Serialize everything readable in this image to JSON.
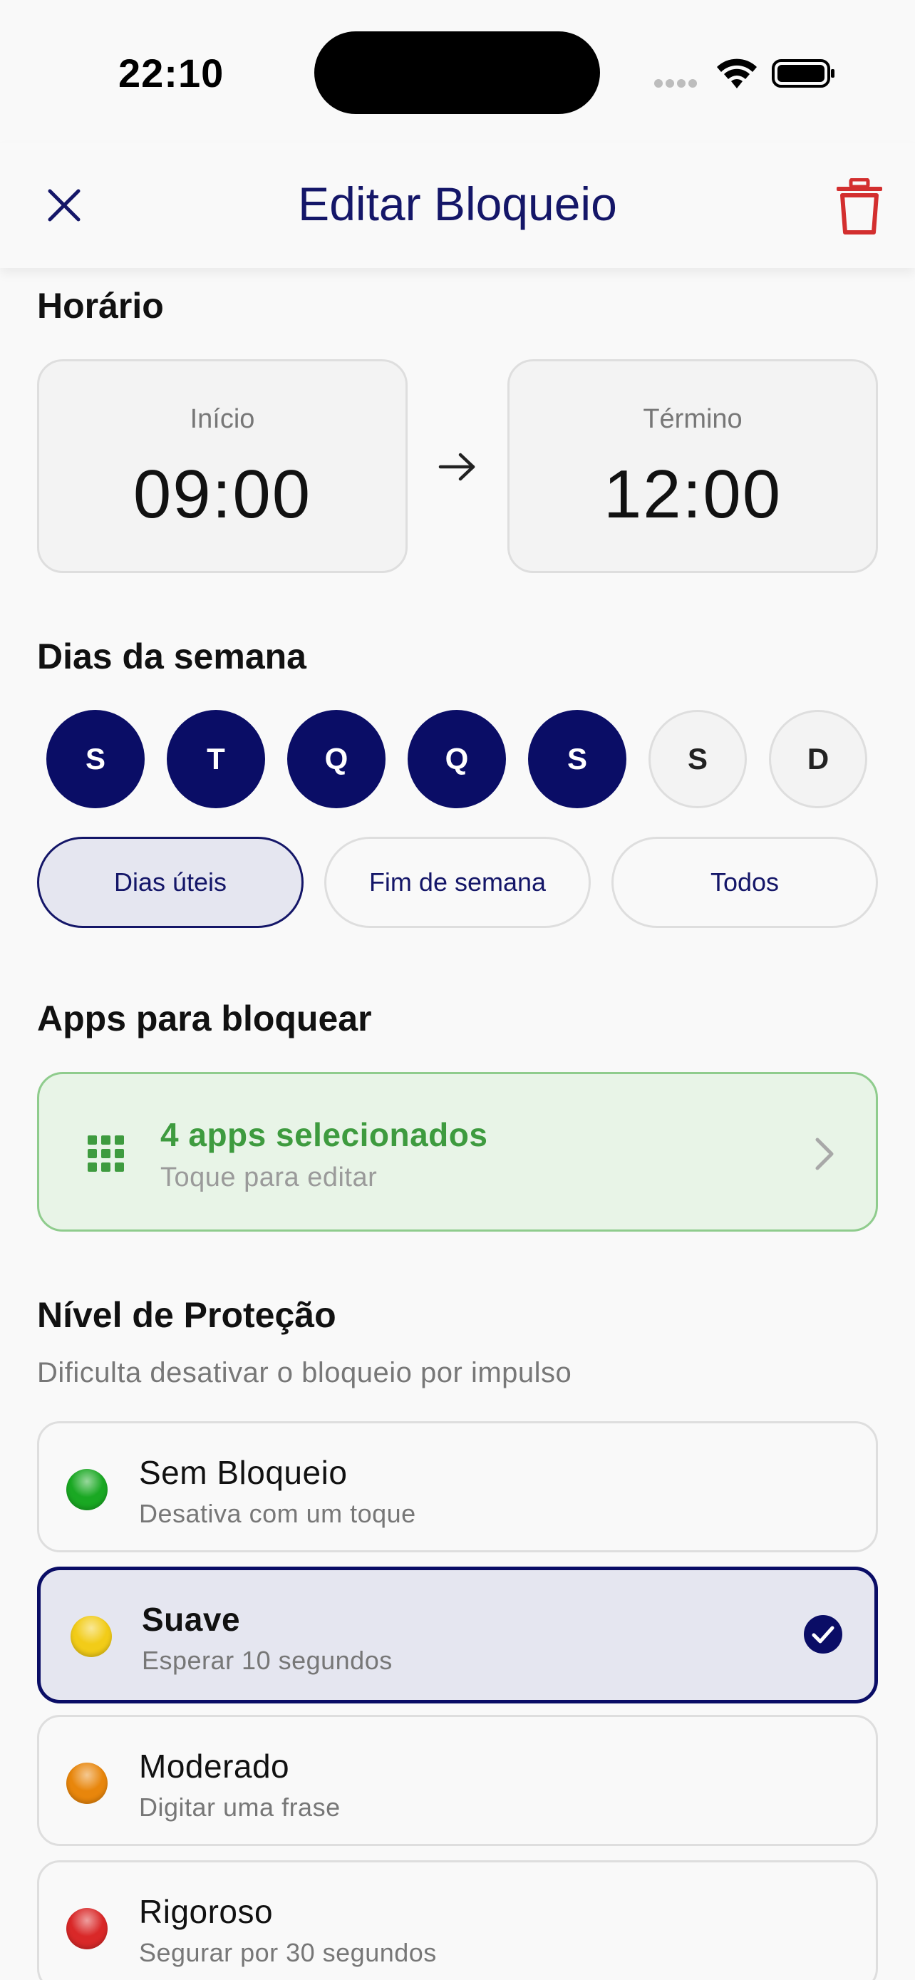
{
  "status_bar": {
    "time": "22:10"
  },
  "nav": {
    "title": "Editar Bloqueio"
  },
  "schedule": {
    "title": "Horário",
    "start": {
      "label": "Início",
      "value": "09:00"
    },
    "end": {
      "label": "Término",
      "value": "12:00"
    }
  },
  "days": {
    "title": "Dias da semana",
    "items": [
      {
        "label": "S",
        "selected": true
      },
      {
        "label": "T",
        "selected": true
      },
      {
        "label": "Q",
        "selected": true
      },
      {
        "label": "Q",
        "selected": true
      },
      {
        "label": "S",
        "selected": true
      },
      {
        "label": "S",
        "selected": false
      },
      {
        "label": "D",
        "selected": false
      }
    ],
    "presets": [
      {
        "label": "Dias úteis",
        "active": true
      },
      {
        "label": "Fim de semana",
        "active": false
      },
      {
        "label": "Todos",
        "active": false
      }
    ]
  },
  "apps": {
    "title": "Apps para bloquear",
    "count_label": "4 apps selecionados",
    "hint": "Toque para editar"
  },
  "protection": {
    "title": "Nível de Proteção",
    "subtitle": "Dificulta desativar o bloqueio por impulso",
    "levels": [
      {
        "name": "Sem Bloqueio",
        "desc": "Desativa com um toque",
        "color": "#1aa823",
        "selected": false
      },
      {
        "name": "Suave",
        "desc": "Esperar 10 segundos",
        "color": "#f2cc18",
        "selected": true
      },
      {
        "name": "Moderado",
        "desc": "Digitar uma frase",
        "color": "#e8860c",
        "selected": false
      },
      {
        "name": "Rigoroso",
        "desc": "Segurar por 30 segundos",
        "color": "#d92828",
        "selected": false
      }
    ]
  },
  "colors": {
    "primary": "#0a0d66",
    "danger": "#d32f2f",
    "success": "#3e9b3f"
  }
}
